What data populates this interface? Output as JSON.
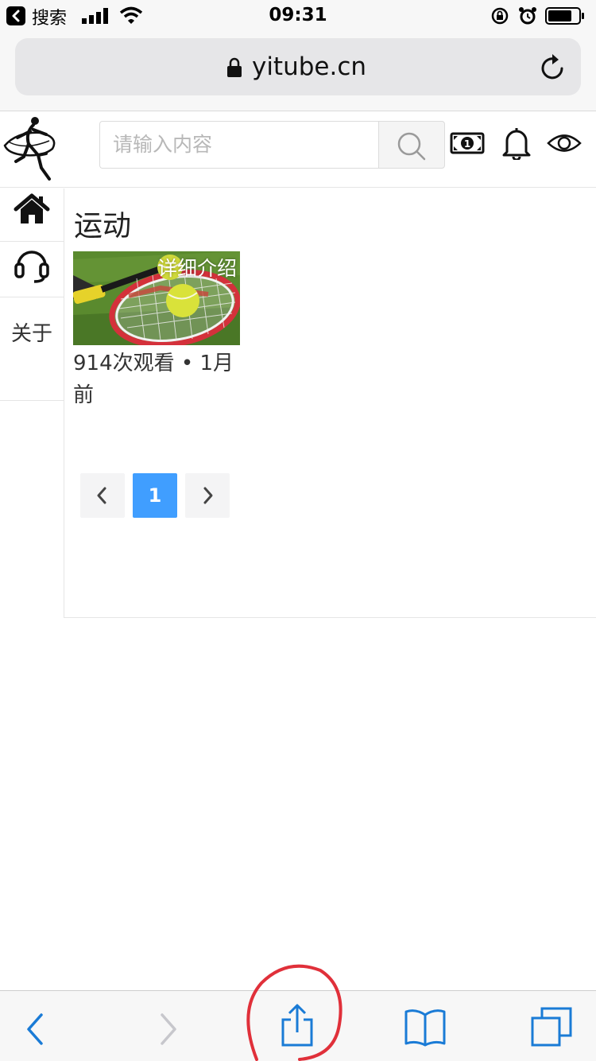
{
  "status_bar": {
    "back_app": "搜索",
    "time": "09:31"
  },
  "browser": {
    "url": "yitube.cn"
  },
  "header": {
    "search_placeholder": "请输入内容"
  },
  "sidebar": {
    "items": [
      {
        "icon": "home-icon"
      },
      {
        "icon": "headset-icon"
      },
      {
        "label": "关于"
      }
    ]
  },
  "main": {
    "section_title": "运动",
    "videos": [
      {
        "thumbnail_overlay": "详细介绍",
        "meta": "914次观看 • 1月前"
      }
    ],
    "pagination": {
      "current_page": "1"
    }
  },
  "colors": {
    "accent": "#409eff",
    "ios_blue": "#1a7bd6",
    "annotation_red": "#e0303a"
  }
}
